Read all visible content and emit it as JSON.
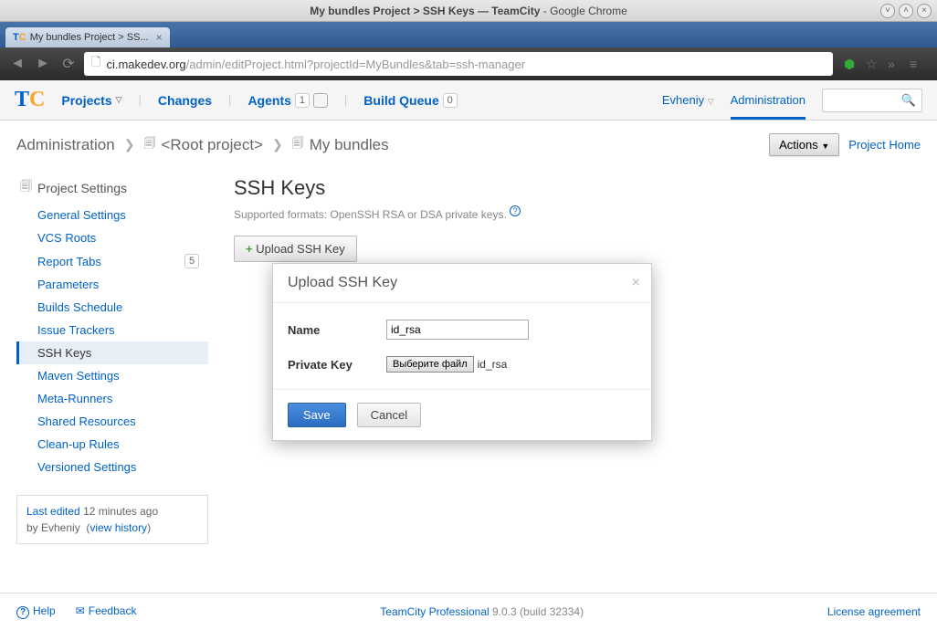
{
  "os": {
    "title_prefix": "My bundles Project > SSH Keys — TeamCity",
    "title_suffix": " - Google Chrome"
  },
  "browser": {
    "tab_title": "My bundles Project > SS...",
    "url_host": "ci.makedev.org",
    "url_path": "/admin/editProject.html?projectId=MyBundles&tab=ssh-manager"
  },
  "nav": {
    "projects": "Projects",
    "changes": "Changes",
    "agents": "Agents",
    "agents_count": "1",
    "build_queue": "Build Queue",
    "queue_count": "0",
    "user": "Evheniy",
    "admin": "Administration"
  },
  "breadcrumb": {
    "root_link": "Administration",
    "root_project": "<Root project>",
    "current": "My bundles",
    "actions": "Actions",
    "project_home": "Project Home"
  },
  "sidebar": {
    "title": "Project Settings",
    "items": [
      {
        "label": "General Settings"
      },
      {
        "label": "VCS Roots"
      },
      {
        "label": "Report Tabs",
        "badge": "5"
      },
      {
        "label": "Parameters"
      },
      {
        "label": "Builds Schedule"
      },
      {
        "label": "Issue Trackers"
      },
      {
        "label": "SSH Keys"
      },
      {
        "label": "Maven Settings"
      },
      {
        "label": "Meta-Runners"
      },
      {
        "label": "Shared Resources"
      },
      {
        "label": "Clean-up Rules"
      },
      {
        "label": "Versioned Settings"
      }
    ],
    "last_edited_prefix": "Last edited",
    "last_edited_time": "12 minutes ago",
    "last_edited_by": "by Evheniy",
    "view_history": "view history"
  },
  "main": {
    "title": "SSH Keys",
    "subtitle": "Supported formats: OpenSSH RSA or DSA private keys.",
    "upload_button": "Upload SSH Key"
  },
  "modal": {
    "title": "Upload SSH Key",
    "name_label": "Name",
    "name_value": "id_rsa",
    "key_label": "Private Key",
    "file_button": "Выберите файл",
    "file_name": "id_rsa",
    "save": "Save",
    "cancel": "Cancel"
  },
  "footer": {
    "help": "Help",
    "feedback": "Feedback",
    "product": "TeamCity Professional",
    "version": " 9.0.3 (build 32334)",
    "license": "License agreement"
  }
}
